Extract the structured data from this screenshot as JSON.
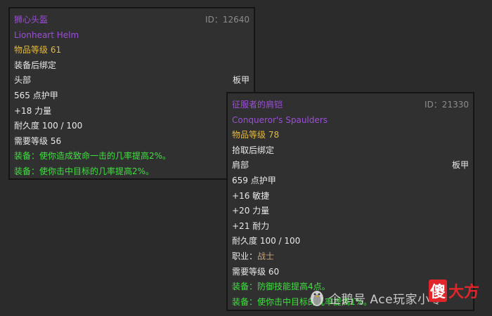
{
  "tooltips": [
    {
      "name_cn": "狮心头盔",
      "id": "ID：12640",
      "name_en": "Lionheart Helm",
      "item_level": "物品等级 61",
      "bind": "装备后绑定",
      "slot": "头部",
      "armor_type": "板甲",
      "stats": [
        "565 点护甲",
        "+18 力量"
      ],
      "durability": "耐久度 100 / 100",
      "required_level": "需要等级 56",
      "effects": [
        "装备：使你造成致命一击的几率提高2%。",
        "装备：使你击中目标的几率提高2%。"
      ]
    },
    {
      "name_cn": "征服者的肩铠",
      "id": "ID：21330",
      "name_en": "Conqueror's Spaulders",
      "item_level": "物品等级 78",
      "bind": "拾取后绑定",
      "slot": "肩部",
      "armor_type": "板甲",
      "stats": [
        "659 点护甲",
        "+16 敏捷",
        "+20 力量",
        "+21 耐力"
      ],
      "durability": "耐久度 100 / 100",
      "class_label": "职业：",
      "class_value": "战士",
      "required_level": "需要等级 60",
      "effects": [
        "装备：防御技能提高4点。",
        "装备：使你击中目标的几率提高1%。"
      ]
    }
  ],
  "watermark": {
    "text": "企鹅号 Ace玩家小零",
    "brand_char": "傻",
    "brand_rest": "大方"
  },
  "colors": {
    "item_name": "#9b4fd8",
    "item_level": "#e3b93c",
    "effect": "#3fe13f",
    "class": "#c9a27a"
  }
}
